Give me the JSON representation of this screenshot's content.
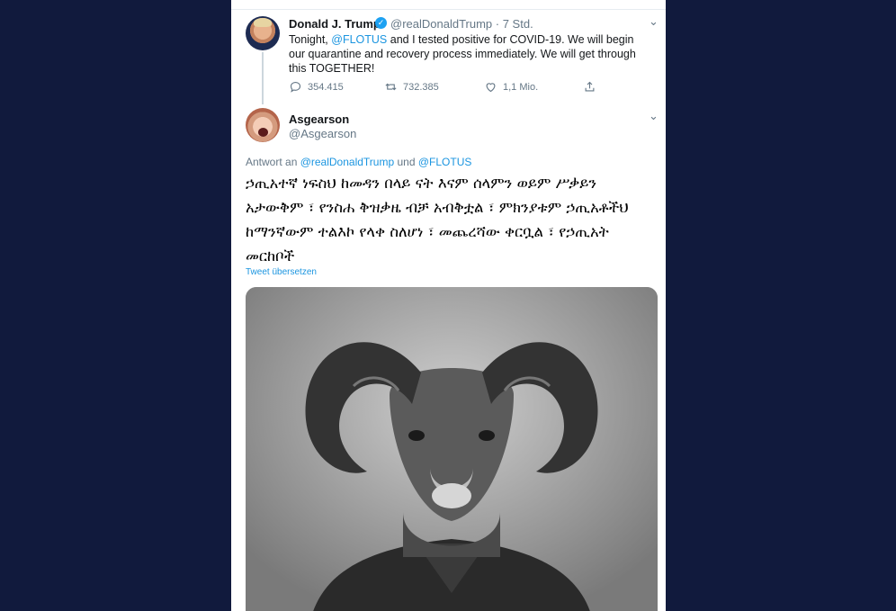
{
  "tweet1": {
    "name": "Donald J. Trump",
    "handle": "@realDonaldTrump",
    "sep": " · ",
    "time": "7 Std.",
    "text_pre": "Tonight, ",
    "mention": "@FLOTUS",
    "text_post": " and I tested positive for COVID-19. We will begin our quarantine and recovery process immediately. We will get through this TOGETHER!",
    "replies": "354.415",
    "retweets": "732.385",
    "likes": "1,1 Mio."
  },
  "tweet2": {
    "name": "Asgearson",
    "handle": "@Asgearson",
    "reply_prefix": "Antwort an ",
    "reply_mention1": "@realDonaldTrump",
    "reply_and": " und ",
    "reply_mention2": "@FLOTUS",
    "text": "ኃጢአተኛ ነፍስህ ከመዳን በላይ ናት እናም ሰላምን ወይም ሥቃይን አታውቅም ፣ የንስሐ ቅዝቃዜ ብቻ አብቅቷል ፣ ምክንያቱም ኃጢአቶችህ ከማንኛውም ተልእኮ የላቀ ስለሆነ ፣ መጨረሻው ቀርቧል ፣ የኃጢአት መርከቦች",
    "translate": "Tweet übersetzen"
  },
  "colors": {
    "background": "#111a3d",
    "link": "#1b95e0",
    "text": "#14171a",
    "muted": "#657786"
  }
}
